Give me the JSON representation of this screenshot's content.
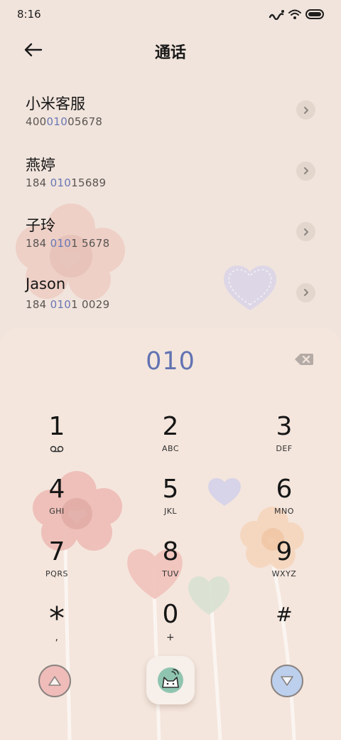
{
  "status_bar": {
    "time": "8:16"
  },
  "header": {
    "title": "通话"
  },
  "contacts": [
    {
      "name": "小米客服",
      "number_pre": "400",
      "number_match": "010",
      "number_post": "05678"
    },
    {
      "name": "燕婷",
      "number_pre": "184 ",
      "number_match": "010",
      "number_post": "15689"
    },
    {
      "name": "子玲",
      "number_pre": "184 ",
      "number_match": "010",
      "number_post": "1 5678"
    },
    {
      "name": "Jason",
      "number_pre": "184 ",
      "number_match": "010",
      "number_post": "1 0029"
    }
  ],
  "dialpad": {
    "input": "010",
    "keys": [
      {
        "digit": "1",
        "letters": ""
      },
      {
        "digit": "2",
        "letters": "ABC"
      },
      {
        "digit": "3",
        "letters": "DEF"
      },
      {
        "digit": "4",
        "letters": "GHI"
      },
      {
        "digit": "5",
        "letters": "JKL"
      },
      {
        "digit": "6",
        "letters": "MNO"
      },
      {
        "digit": "7",
        "letters": "PQRS"
      },
      {
        "digit": "8",
        "letters": "TUV"
      },
      {
        "digit": "9",
        "letters": "WXYZ"
      },
      {
        "digit": "*",
        "letters": ","
      },
      {
        "digit": "0",
        "letters": "+"
      },
      {
        "digit": "#",
        "letters": ""
      }
    ]
  },
  "icons": {
    "back": "arrow-left-icon",
    "chevron": "chevron-right-icon",
    "backspace": "backspace-icon",
    "voicemail": "voicemail-icon",
    "call": "cat-call-icon",
    "up": "triangle-up-icon",
    "down": "triangle-down-icon"
  },
  "colors": {
    "accent": "#6877b5",
    "background": "#f1e4dc",
    "up_button": "#efbcb9",
    "down_button": "#bccfed"
  }
}
